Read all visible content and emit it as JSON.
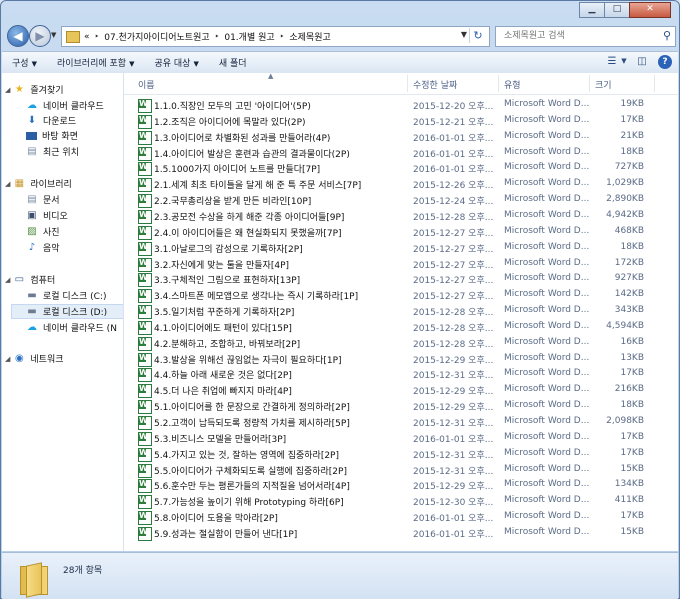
{
  "window": {
    "controls": {
      "minimize": "▁",
      "maximize": "□",
      "close": "✕"
    }
  },
  "address": {
    "prefix": "«",
    "crumbs": [
      "07.천가지아이디어노트원고",
      "01.개별 원고",
      "소제목원고"
    ]
  },
  "search": {
    "placeholder": "소제목원고 검색"
  },
  "toolbar": {
    "organize": "구성",
    "include_library": "라이브러리에 포함",
    "share_with": "공유 대상",
    "new_folder": "새 폴더"
  },
  "nav": {
    "favorites": "즐겨찾기",
    "favorites_items": [
      "네이버 클라우드",
      "다운로드",
      "바탕 화면",
      "최근 위치"
    ],
    "libraries": "라이브러리",
    "libraries_items": [
      "문서",
      "비디오",
      "사진",
      "음악"
    ],
    "computer": "컴퓨터",
    "computer_items": [
      "로컬 디스크 (C:)",
      "로컬 디스크 (D:)",
      "네이버 클라우드 (N"
    ],
    "network": "네트워크"
  },
  "columns": {
    "name": "이름",
    "modified": "수정한 날짜",
    "type": "유형",
    "size": "크기"
  },
  "files": [
    {
      "name": "1.1.0.직장인 모두의 고민 '아이디어'(5P)",
      "modified": "2015-12-20 오후...",
      "type": "Microsoft Word D...",
      "size": "19KB"
    },
    {
      "name": "1.2.조직은 아이디어에 목말라 있다(2P)",
      "modified": "2015-12-21 오후...",
      "type": "Microsoft Word D...",
      "size": "17KB"
    },
    {
      "name": "1.3.아이디어로 차별화된 성과를 만들어라(4P)",
      "modified": "2016-01-01 오후...",
      "type": "Microsoft Word D...",
      "size": "21KB"
    },
    {
      "name": "1.4.아이디어 발상은 훈련과 습관의 결과물이다(2P)",
      "modified": "2016-01-01 오후...",
      "type": "Microsoft Word D...",
      "size": "18KB"
    },
    {
      "name": "1.5.1000가지 아이디어 노트를 만들다[7P]",
      "modified": "2016-01-01 오후...",
      "type": "Microsoft Word D...",
      "size": "727KB"
    },
    {
      "name": "2.1.세계 최초 타이틀을 달게 해 준 특 주문 서비스[7P]",
      "modified": "2015-12-26 오후...",
      "type": "Microsoft Word D...",
      "size": "1,029KB"
    },
    {
      "name": "2.2.국무총리상을 받게 만든 비라인[10P]",
      "modified": "2015-12-24 오후...",
      "type": "Microsoft Word D...",
      "size": "2,890KB"
    },
    {
      "name": "2.3.공모전 수상을 하게 해준 각종 아이디어들[9P]",
      "modified": "2015-12-28 오후...",
      "type": "Microsoft Word D...",
      "size": "4,942KB"
    },
    {
      "name": "2.4.이 아이디어들은 왜 현실화되지 못했을까[7P]",
      "modified": "2015-12-27 오후...",
      "type": "Microsoft Word D...",
      "size": "468KB"
    },
    {
      "name": "3.1.아날로그의 감성으로 기록하자[2P]",
      "modified": "2015-12-27 오후...",
      "type": "Microsoft Word D...",
      "size": "18KB"
    },
    {
      "name": "3.2.자신에게 맞는 툴을 만들자[4P]",
      "modified": "2015-12-27 오후...",
      "type": "Microsoft Word D...",
      "size": "172KB"
    },
    {
      "name": "3.3.구체적인 그림으로 표현하자[13P]",
      "modified": "2015-12-27 오후...",
      "type": "Microsoft Word D...",
      "size": "927KB"
    },
    {
      "name": "3.4.스마트폰 메모앱으로 생각나는 즉시 기록하라[1P]",
      "modified": "2015-12-27 오후...",
      "type": "Microsoft Word D...",
      "size": "142KB"
    },
    {
      "name": "3.5.일기처럼 꾸준하게 기록하자[2P]",
      "modified": "2015-12-28 오후...",
      "type": "Microsoft Word D...",
      "size": "343KB"
    },
    {
      "name": "4.1.아이디어에도 패턴이 있다[15P]",
      "modified": "2015-12-28 오후...",
      "type": "Microsoft Word D...",
      "size": "4,594KB"
    },
    {
      "name": "4.2.분해하고, 조합하고, 바꿔보라[2P]",
      "modified": "2015-12-28 오후...",
      "type": "Microsoft Word D...",
      "size": "16KB"
    },
    {
      "name": "4.3.발상을 위해선 끊임없는 자극이 필요하다[1P]",
      "modified": "2015-12-29 오후...",
      "type": "Microsoft Word D...",
      "size": "13KB"
    },
    {
      "name": "4.4.하늘 아래 새로운 것은 없다[2P]",
      "modified": "2015-12-31 오후...",
      "type": "Microsoft Word D...",
      "size": "17KB"
    },
    {
      "name": "4.5.더 나은 취업에 빠지지 마라[4P]",
      "modified": "2015-12-29 오후...",
      "type": "Microsoft Word D...",
      "size": "216KB"
    },
    {
      "name": "5.1.아이디어를 한 문장으로 간결하게 정의하라[2P]",
      "modified": "2015-12-29 오후...",
      "type": "Microsoft Word D...",
      "size": "18KB"
    },
    {
      "name": "5.2.고객이 납득되도록 정량적 가치를 제시하라[5P]",
      "modified": "2015-12-31 오후...",
      "type": "Microsoft Word D...",
      "size": "2,098KB"
    },
    {
      "name": "5.3.비즈니스 모델을 만들어라[3P]",
      "modified": "2016-01-01 오후...",
      "type": "Microsoft Word D...",
      "size": "17KB"
    },
    {
      "name": "5.4.가지고 있는 것, 잘하는 영역에 집중하라[2P]",
      "modified": "2015-12-31 오후...",
      "type": "Microsoft Word D...",
      "size": "17KB"
    },
    {
      "name": "5.5.아이디어가 구체화되도록 실행에 집중하라[2P]",
      "modified": "2015-12-31 오후...",
      "type": "Microsoft Word D...",
      "size": "15KB"
    },
    {
      "name": "5.6.훈수만 두는 평론가들의 지적질을 넘어서라[4P]",
      "modified": "2015-12-29 오후...",
      "type": "Microsoft Word D...",
      "size": "134KB"
    },
    {
      "name": "5.7.가능성을 높이기 위해 Prototyping 하라[6P]",
      "modified": "2015-12-30 오후...",
      "type": "Microsoft Word D...",
      "size": "411KB"
    },
    {
      "name": "5.8.아이디어 도용을 막아라[2P]",
      "modified": "2016-01-01 오후...",
      "type": "Microsoft Word D...",
      "size": "17KB"
    },
    {
      "name": "5.9.성과는 절실함이 만들어 낸다[1P]",
      "modified": "2016-01-01 오후...",
      "type": "Microsoft Word D...",
      "size": "15KB"
    }
  ],
  "status": {
    "count": "28개 항목"
  }
}
